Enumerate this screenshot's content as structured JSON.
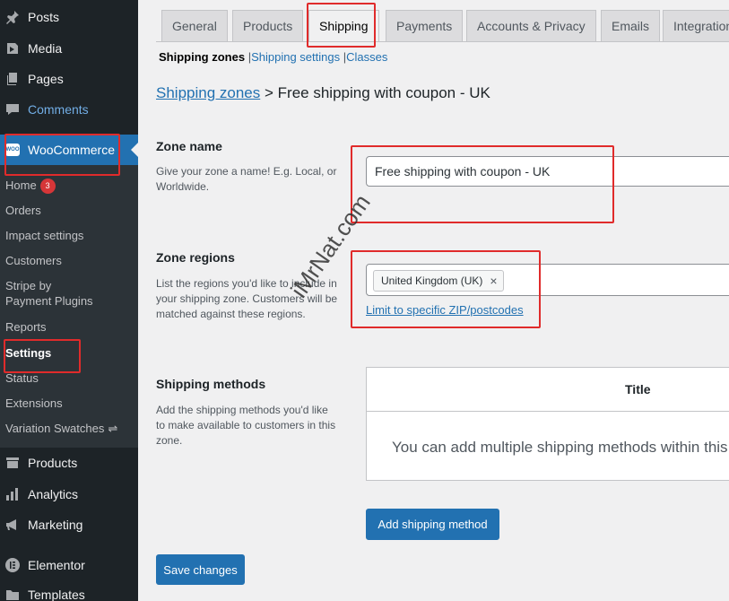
{
  "sidebar": {
    "top_items": [
      {
        "label": "Posts",
        "icon": "pushpin-icon"
      },
      {
        "label": "Media",
        "icon": "media-icon"
      },
      {
        "label": "Pages",
        "icon": "pages-icon"
      },
      {
        "label": "Comments",
        "icon": "comment-icon"
      }
    ],
    "woocommerce": {
      "label": "WooCommerce",
      "icon_text": "WOO"
    },
    "submenu": {
      "home": "Home",
      "home_badge": "3",
      "orders": "Orders",
      "impact": "Impact settings",
      "customers": "Customers",
      "stripe_line1": "Stripe by",
      "stripe_line2": "Payment Plugins",
      "reports": "Reports",
      "settings": "Settings",
      "status": "Status",
      "extensions": "Extensions",
      "swatches": "Variation Swatches"
    },
    "bottom_items": [
      {
        "label": "Products",
        "icon": "archive-icon"
      },
      {
        "label": "Analytics",
        "icon": "bar-chart-icon"
      },
      {
        "label": "Marketing",
        "icon": "megaphone-icon"
      },
      {
        "label": "Elementor",
        "icon": "elementor-icon"
      },
      {
        "label": "Templates",
        "icon": "folder-icon"
      }
    ]
  },
  "tabs": [
    "General",
    "Products",
    "Shipping",
    "Payments",
    "Accounts & Privacy",
    "Emails",
    "Integration"
  ],
  "active_tab": "Shipping",
  "subnav": {
    "current": "Shipping zones",
    "sep1": "|",
    "link1": "Shipping settings",
    "sep2": "|",
    "link2": "Classes"
  },
  "heading": {
    "link": "Shipping zones",
    "sep": ">",
    "title": "Free shipping with coupon - UK"
  },
  "zone_name": {
    "title": "Zone name",
    "desc": "Give your zone a name! E.g. Local, or Worldwide.",
    "value": "Free shipping with coupon - UK"
  },
  "zone_regions": {
    "title": "Zone regions",
    "desc": "List the regions you'd like to include in your shipping zone. Customers will be matched against these regions.",
    "chip": "United Kingdom (UK)",
    "chip_remove": "×",
    "zip_link": "Limit to specific ZIP/postcodes"
  },
  "shipping_methods": {
    "title": "Shipping methods",
    "desc": "Add the shipping methods you'd like to make available to customers in this zone.",
    "table_header": "Title",
    "empty_text": "You can add multiple shipping methods within this",
    "add_button": "Add shipping method"
  },
  "save_button": "Save changes",
  "watermark": "iMrNat.com",
  "colors": {
    "admin_bar": "#1d2327",
    "submenu": "#2c3338",
    "accent": "#2271b1",
    "highlight": "#e02b2b",
    "badge": "#d63638"
  }
}
